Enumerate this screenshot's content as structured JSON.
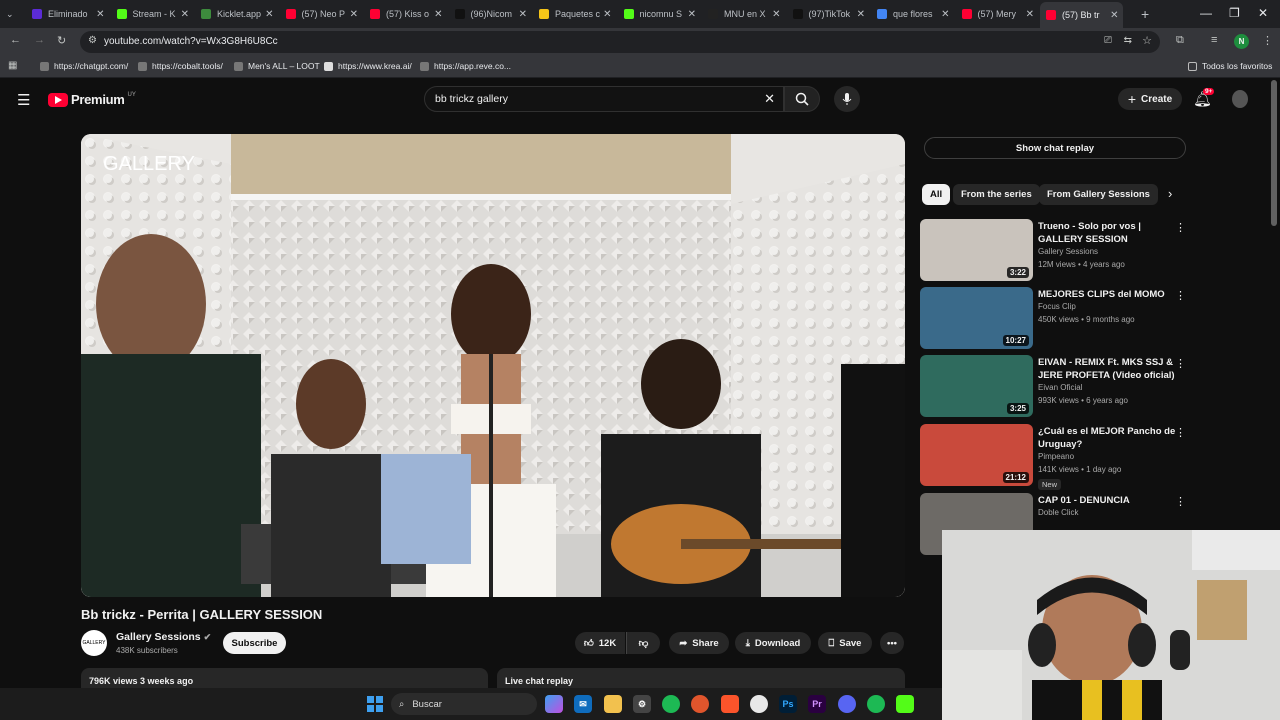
{
  "browser": {
    "tabs": [
      {
        "label": "Eliminado",
        "color": "#5b2bd6"
      },
      {
        "label": "Stream - K",
        "color": "#53fc18"
      },
      {
        "label": "Kicklet.app",
        "color": "#3d8b3d"
      },
      {
        "label": "(57) Neo P",
        "color": "#ff0033"
      },
      {
        "label": "(57) Kiss o",
        "color": "#ff0033"
      },
      {
        "label": "(96)Nicom",
        "color": "#111111"
      },
      {
        "label": "Paquetes c",
        "color": "#f5c518"
      },
      {
        "label": "nicomnu S",
        "color": "#53fc18"
      },
      {
        "label": "MNU en X",
        "color": "#222222"
      },
      {
        "label": "(97)TikTok",
        "color": "#111111"
      },
      {
        "label": "que flores",
        "color": "#4285f4"
      },
      {
        "label": "(57) Mery",
        "color": "#ff0033"
      },
      {
        "label": "(57) Bb tr",
        "color": "#ff0033"
      }
    ],
    "url": "youtube.com/watch?v=Wx3G8H6U8Cc",
    "profile_initial": "N",
    "bookmarks": [
      "https://chatgpt.com/",
      "https://cobalt.tools/",
      "Men's ALL – LOOT",
      "https://www.krea.ai/",
      "https://app.reve.co...",
      "Todos los favoritos"
    ]
  },
  "youtube": {
    "logo_text": "Premium",
    "region": "UY",
    "search_query": "bb trickz gallery",
    "create_label": "Create",
    "notif_count": "9+",
    "video": {
      "overlay_text": "GALLERY",
      "title": "Bb trickz - Perrita | GALLERY SESSION",
      "channel": "Gallery Sessions",
      "channel_avatar_text": "GALLERY",
      "subscribers": "438K subscribers",
      "subscribe_label": "Subscribe",
      "likes": "12K",
      "share_label": "Share",
      "download_label": "Download",
      "save_label": "Save",
      "views_date": "796K views  3 weeks ago",
      "live_chat_label": "Live chat replay"
    },
    "chat_replay_label": "Show chat replay",
    "chips": [
      "All",
      "From the series",
      "From Gallery Sessions"
    ],
    "recommendations": [
      {
        "title": "Trueno - Solo por vos | GALLERY SESSION",
        "channel": "Gallery Sessions",
        "meta": "12M views • 4 years ago",
        "duration": "3:22",
        "thumb": "#c9c3bc"
      },
      {
        "title": "MEJORES CLIPS del MOMO",
        "channel": "Focus Clip",
        "meta": "450K views • 9 months ago",
        "duration": "10:27",
        "thumb": "#3a6a8a"
      },
      {
        "title": "EIVAN - REMIX Ft. MKS SSJ & JERE PROFETA (Video oficial)",
        "channel": "Eivan Oficial",
        "meta": "993K views • 6 years ago",
        "duration": "3:25",
        "thumb": "#2f6b5e"
      },
      {
        "title": "¿Cuál es el MEJOR Pancho de Uruguay?",
        "channel": "Pimpeano",
        "meta": "141K views • 1 day ago",
        "badge": "New",
        "duration": "21:12",
        "thumb": "#c94a3c"
      },
      {
        "title": "CAP 01 - DENUNCIA",
        "channel": "Doble Click",
        "meta": "",
        "duration": "",
        "thumb": "#6d6a66"
      }
    ]
  },
  "taskbar": {
    "search_label": "Buscar"
  }
}
